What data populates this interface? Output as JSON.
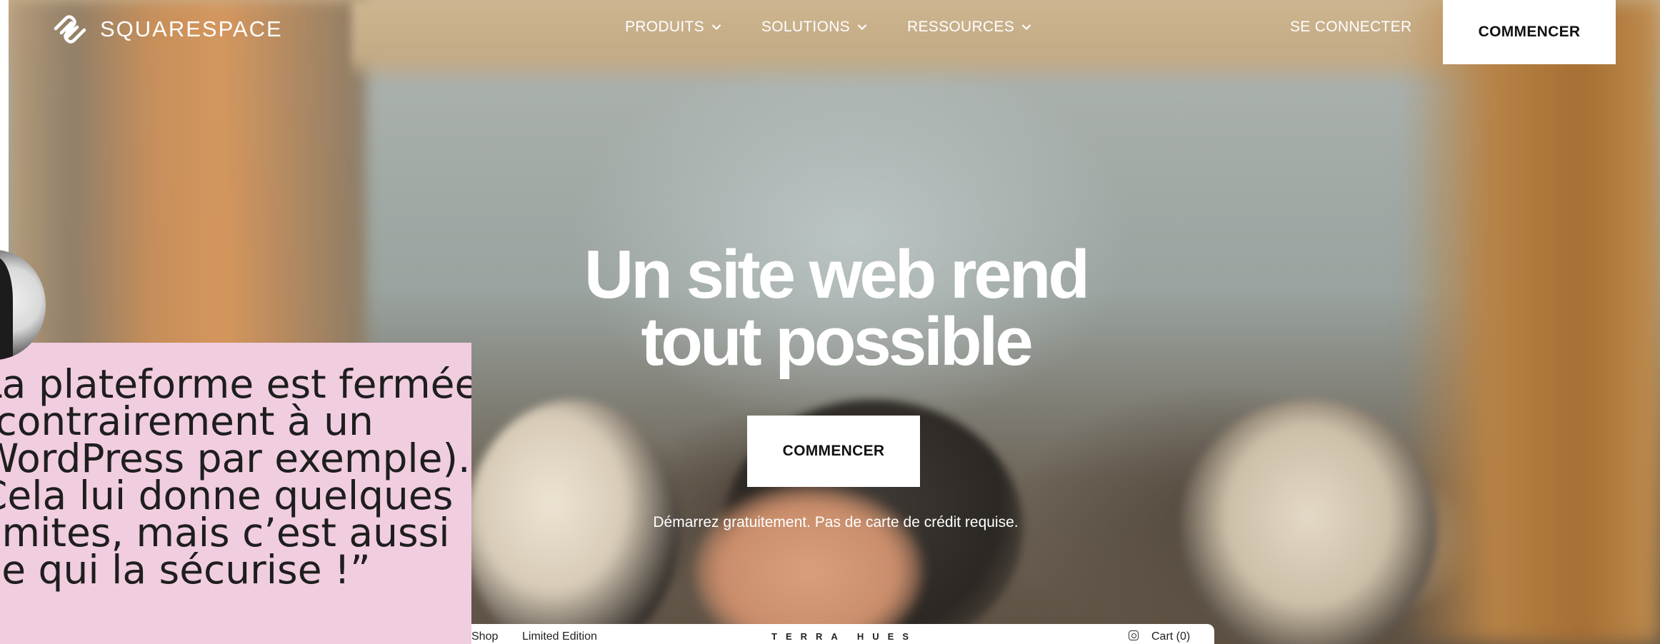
{
  "brand": {
    "name": "SQUARESPACE"
  },
  "nav": {
    "items": [
      {
        "label": "PRODUITS"
      },
      {
        "label": "SOLUTIONS"
      },
      {
        "label": "RESSOURCES"
      }
    ],
    "signin_label": "SE CONNECTER",
    "cta_label": "COMMENCER"
  },
  "hero": {
    "headline_line1": "Un site web rend",
    "headline_line2": "tout possible",
    "cta_label": "COMMENCER",
    "subtext": "Démarrez gratuitement. Pas de carte de crédit requise."
  },
  "preview": {
    "shop": "Shop",
    "limited": "Limited Edition",
    "brand": "TERRA HUES",
    "cart": "Cart (0)"
  },
  "testimonial": {
    "quote": "La plateforme est fermée (contrairement à un WordPress par exemple). Cela lui donne quelques limites, mais c’est aussi ce qui la sécurise !”"
  },
  "colors": {
    "quote_bg": "#f1cde0",
    "cta_bg": "#ffffff",
    "text_on_hero": "#ffffff"
  }
}
